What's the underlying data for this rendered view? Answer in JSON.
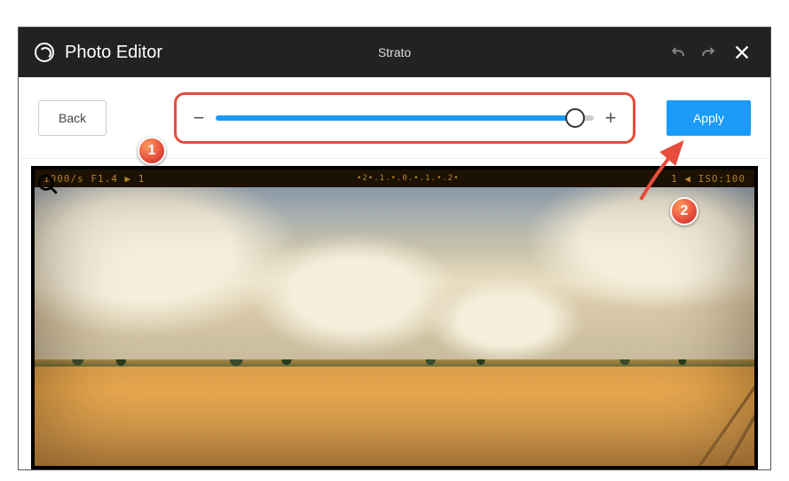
{
  "header": {
    "app_title": "Photo Editor",
    "filter_name": "Strato"
  },
  "toolbar": {
    "back_label": "Back",
    "apply_label": "Apply",
    "minus": "−",
    "plus": "+",
    "slider_value": 95
  },
  "film": {
    "left_text": "1000/s F1.4 ▶ 1",
    "mid_text": "•2•.1.•.0.•.1.•.2•",
    "right_text": "1 ◀  ISO:100"
  },
  "annotations": {
    "badge1": "1",
    "badge2": "2"
  }
}
